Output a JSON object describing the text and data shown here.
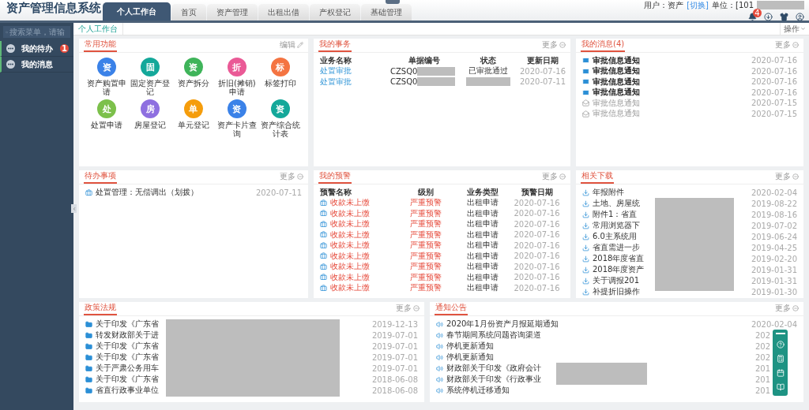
{
  "header": {
    "title": "资产管理信息系统",
    "tabs": [
      {
        "label": "个人工作台",
        "selected": true
      },
      {
        "label": "首页",
        "selected": false
      },
      {
        "label": "资产管理",
        "selected": false
      },
      {
        "label": "出租出借",
        "selected": false
      },
      {
        "label": "产权登记",
        "selected": false
      },
      {
        "label": "基础管理",
        "selected": false
      }
    ],
    "user_label": "用户：资产",
    "switch_link": "[切换]",
    "unit_label": "单位：[101",
    "unit_redacted": true,
    "notification_count": "4"
  },
  "sidebar": {
    "search_placeholder": "搜索菜单，请输",
    "items": [
      {
        "label": "我的待办",
        "badge": "1"
      },
      {
        "label": "我的消息"
      }
    ]
  },
  "breadcrumb": {
    "tab": "个人工作台",
    "operations": "操作"
  },
  "quick_functions": {
    "title": "常用功能",
    "action": "编辑",
    "items": [
      {
        "glyph": "资",
        "label": "资产购置申请",
        "color": "#3b82e8"
      },
      {
        "glyph": "固",
        "label": "固定资产登记",
        "color": "#14a89a"
      },
      {
        "glyph": "资",
        "label": "资产拆分",
        "color": "#3fb45a"
      },
      {
        "glyph": "折",
        "label": "折旧(摊销)申请",
        "color": "#ea5a96"
      },
      {
        "glyph": "标",
        "label": "标签打印",
        "color": "#f47442"
      },
      {
        "glyph": "处",
        "label": "处置申请",
        "color": "#7cc04b"
      },
      {
        "glyph": "房",
        "label": "房屋登记",
        "color": "#8e6fe0"
      },
      {
        "glyph": "单",
        "label": "单元登记",
        "color": "#f59d0c"
      },
      {
        "glyph": "资",
        "label": "资产卡片查询",
        "color": "#3b82e8"
      },
      {
        "glyph": "资",
        "label": "资产综合统计表",
        "color": "#14a89a"
      }
    ]
  },
  "my_business": {
    "title": "我的事务",
    "more": "更多",
    "columns": [
      "业务名称",
      "单据编号",
      "状态",
      "更新日期"
    ],
    "rows": [
      {
        "name": "处置审批",
        "number": "CZSQ0",
        "status": "已审批通过",
        "date": "2020-07-16",
        "redacted": true
      },
      {
        "name": "处置审批",
        "number": "CZSQ0",
        "date": "2020-07-11",
        "redacted": true
      }
    ]
  },
  "my_messages": {
    "title": "我的消息(4)",
    "more": "更多",
    "items": [
      {
        "text": "审批信息通知",
        "date": "2020-07-16",
        "read": false
      },
      {
        "text": "审批信息通知",
        "date": "2020-07-16",
        "read": false
      },
      {
        "text": "审批信息通知",
        "date": "2020-07-16",
        "read": false
      },
      {
        "text": "审批信息通知",
        "date": "2020-07-16",
        "read": false
      },
      {
        "text": "审批信息通知",
        "date": "2020-07-15",
        "read": true
      },
      {
        "text": "审批信息通知",
        "date": "2020-07-15",
        "read": true
      }
    ]
  },
  "todo": {
    "title": "待办事项",
    "more": "更多",
    "items": [
      {
        "text": "处置管理：无偿调出（划拨）",
        "date": "2020-07-11"
      }
    ]
  },
  "warnings": {
    "title": "我的预警",
    "more": "更多",
    "columns": [
      "预警名称",
      "级别",
      "业务类型",
      "预警日期"
    ],
    "rows": [
      {
        "name": "收款未上缴",
        "level": "严重预警",
        "type": "出租申请",
        "date": "2020-07-16"
      },
      {
        "name": "收款未上缴",
        "level": "严重预警",
        "type": "出租申请",
        "date": "2020-07-16"
      },
      {
        "name": "收款未上缴",
        "level": "严重预警",
        "type": "出租申请",
        "date": "2020-07-16"
      },
      {
        "name": "收款未上缴",
        "level": "严重预警",
        "type": "出租申请",
        "date": "2020-07-16"
      },
      {
        "name": "收款未上缴",
        "level": "严重预警",
        "type": "出租申请",
        "date": "2020-07-16"
      },
      {
        "name": "收款未上缴",
        "level": "严重预警",
        "type": "出租申请",
        "date": "2020-07-16"
      },
      {
        "name": "收款未上缴",
        "level": "严重预警",
        "type": "出租申请",
        "date": "2020-07-16"
      },
      {
        "name": "收款未上缴",
        "level": "严重预警",
        "type": "出租申请",
        "date": "2020-07-16"
      },
      {
        "name": "收款未上缴",
        "level": "严重预警",
        "type": "出租申请",
        "date": "2020-07-16"
      }
    ]
  },
  "downloads": {
    "title": "相关下载",
    "more": "更多",
    "redacted": true,
    "items": [
      {
        "text": "年报附件",
        "date": "2020-02-04"
      },
      {
        "text": "土地、房屋统",
        "date": "2019-08-22"
      },
      {
        "text": "附件1：省直",
        "date": "2019-08-16"
      },
      {
        "text": "常用浏览器下",
        "date": "2019-07-02"
      },
      {
        "text": "6.0主系统用",
        "date": "2019-06-24"
      },
      {
        "text": "省直需进一步",
        "date": "2019-04-25"
      },
      {
        "text": "2018年度省直",
        "date": "2019-02-20"
      },
      {
        "text": "2018年度资产",
        "date": "2019-01-31"
      },
      {
        "text": "关于调报201",
        "date": "2019-01-31"
      },
      {
        "text": "补提折旧操作",
        "date": "2019-01-30"
      }
    ]
  },
  "policies": {
    "title": "政策法规",
    "more": "更多",
    "redacted": true,
    "items": [
      {
        "text": "关于印发《广东省",
        "date": "2019-12-13"
      },
      {
        "text": "转发财政部关于进",
        "date": "2019-07-01"
      },
      {
        "text": "关于印发《广东省",
        "date": "2019-07-01"
      },
      {
        "text": "关于印发《广东省",
        "date": "2019-07-01"
      },
      {
        "text": "关于严肃公务用车",
        "date": "2019-07-01"
      },
      {
        "text": "关于印发《广东省",
        "date": "2018-06-08"
      },
      {
        "text": "省直行政事业单位",
        "date": "2018-06-08"
      }
    ]
  },
  "notices": {
    "title": "通知公告",
    "more": "更多",
    "redacted": true,
    "items": [
      {
        "text": "2020年1月份资产月报延期通知",
        "date": "2020-02-04"
      },
      {
        "text": "春节期间系统问题咨询渠道",
        "date": "202"
      },
      {
        "text": "停机更新通知",
        "date": "202"
      },
      {
        "text": "停机更新通知",
        "date": "202"
      },
      {
        "text": "财政部关于印发《政府会计",
        "date": "201"
      },
      {
        "text": "财政部关于印发《行政事业",
        "date": "201"
      },
      {
        "text": "系统停机迁移通知",
        "date": "201"
      }
    ]
  }
}
